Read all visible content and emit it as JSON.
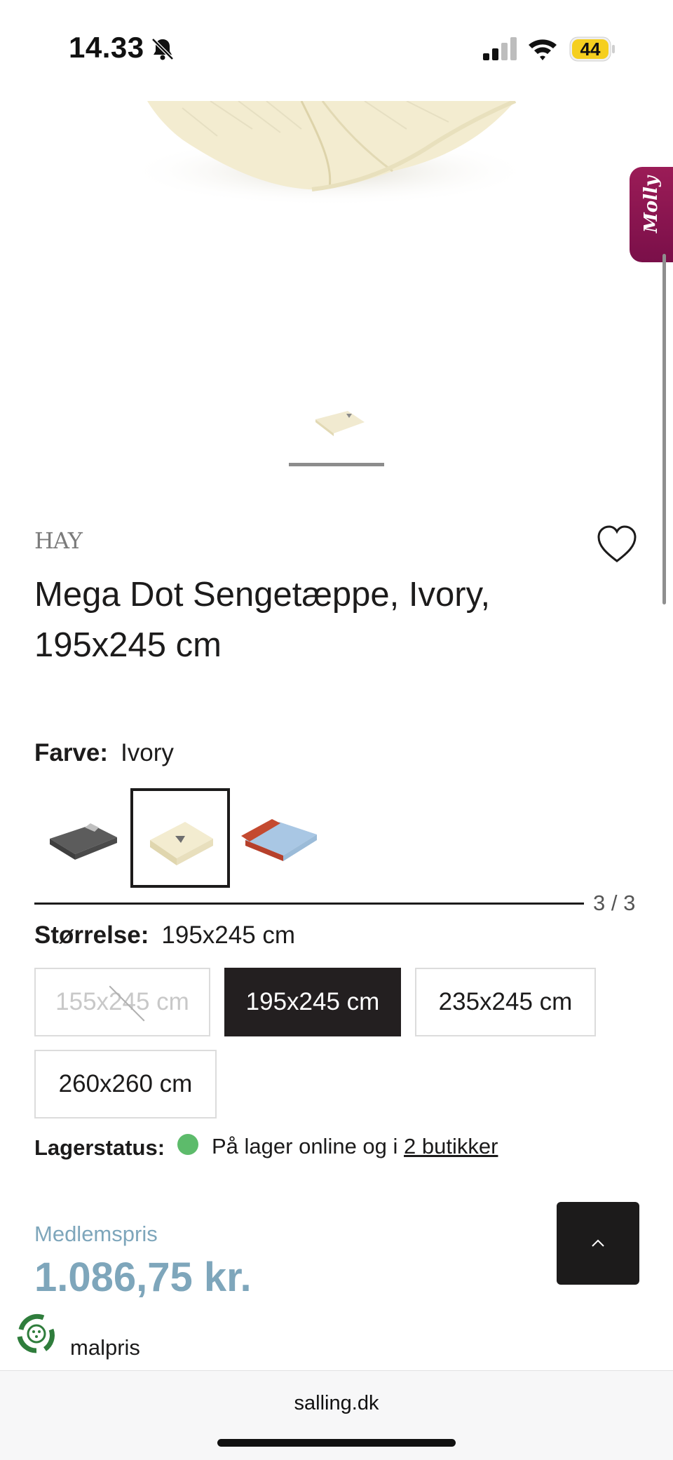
{
  "status_bar": {
    "time": "14.33",
    "battery": "44"
  },
  "molly_tab": {
    "label": "Molly"
  },
  "product": {
    "brand": "HAY",
    "title": "Mega Dot Sengetæppe, Ivory, 195x245 cm",
    "color": {
      "label": "Farve:",
      "value": "Ivory",
      "swatches": [
        "Grey",
        "Ivory",
        "Red/Blue"
      ],
      "counter": "3 / 3"
    },
    "size": {
      "label": "Størrelse:",
      "value": "195x245 cm",
      "options": [
        {
          "label": "155x245 cm",
          "state": "unavailable"
        },
        {
          "label": "195x245 cm",
          "state": "selected"
        },
        {
          "label": "235x245 cm",
          "state": "available"
        },
        {
          "label": "260x260 cm",
          "state": "available"
        }
      ]
    },
    "stock": {
      "label": "Lagerstatus:",
      "text": "På lager online og i ",
      "link": "2 butikker",
      "status_color": "#5dbb6b"
    },
    "price": {
      "member_label": "Medlemspris",
      "member_price": "1.086,75 kr.",
      "normal_label": "malpris"
    }
  },
  "browser": {
    "url": "salling.dk"
  },
  "colors": {
    "accent_price": "#7ea6bb",
    "selected_bg": "#231f20"
  },
  "icons": [
    "bell-slash-icon",
    "signal-icon",
    "wifi-icon",
    "battery-icon",
    "heart-icon",
    "chevron-up-icon",
    "recycle-icon"
  ]
}
